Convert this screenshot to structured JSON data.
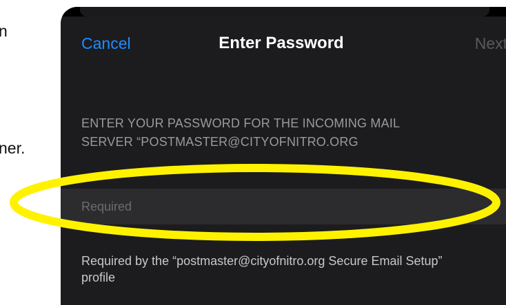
{
  "document": {
    "fragment_1": "n",
    "fragment_2": "ner."
  },
  "sheet": {
    "cancel_label": "Cancel",
    "title": "Enter Password",
    "next_label": "Next",
    "section_header": "ENTER YOUR PASSWORD FOR THE INCOMING MAIL SERVER “POSTMASTER@CITYOFNITRO.ORG",
    "password_placeholder": "Required",
    "footer_note": "Required by the “postmaster@cityofnitro.org Secure Email Setup” profile"
  },
  "annotation": {
    "highlight_color": "#fff200"
  }
}
